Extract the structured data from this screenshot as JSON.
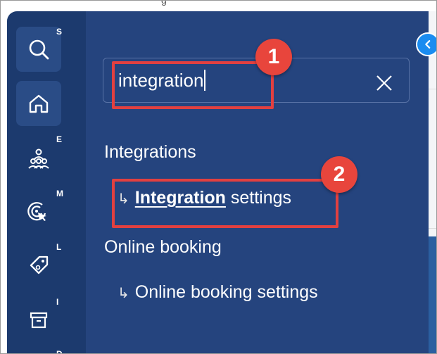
{
  "top_text": "g",
  "rail": {
    "items": [
      {
        "icon": "search-icon",
        "shortcut": "S"
      },
      {
        "icon": "home-icon",
        "shortcut": ""
      },
      {
        "icon": "team-icon",
        "shortcut": "E"
      },
      {
        "icon": "target-click-icon",
        "shortcut": "M"
      },
      {
        "icon": "tag-icon",
        "shortcut": "L"
      },
      {
        "icon": "box-icon",
        "shortcut": "I"
      },
      {
        "icon": "more-icon",
        "shortcut": "D"
      }
    ]
  },
  "search": {
    "value": "integration"
  },
  "results": {
    "sections": [
      {
        "title": "Integrations",
        "items": [
          {
            "arrow": "↳",
            "match": "Integration",
            "rest": " settings"
          }
        ]
      },
      {
        "title": "Online booking",
        "items": [
          {
            "arrow": "↳",
            "match": "",
            "rest": "Online booking settings"
          }
        ]
      }
    ]
  },
  "annotations": {
    "badge1": "1",
    "badge2": "2"
  },
  "colors": {
    "rail": "#1c3a6e",
    "panel": "#25447e",
    "highlight_box": "#e24040",
    "badge": "#e8453c",
    "accent": "#1a8cf0"
  }
}
